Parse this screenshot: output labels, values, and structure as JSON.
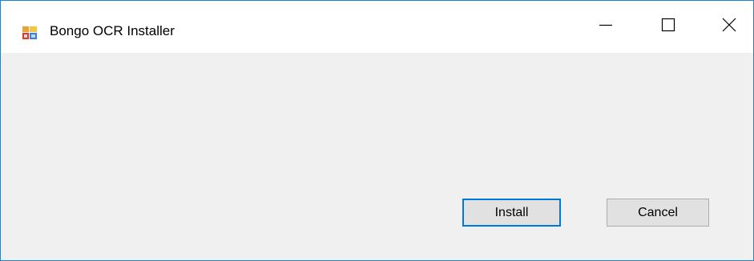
{
  "window": {
    "title": "Bongo OCR Installer",
    "app_icon": "installer-app-icon",
    "accent_border": "#1883d7"
  },
  "caption_buttons": {
    "minimize_icon": "minimize-icon",
    "maximize_icon": "maximize-icon",
    "close_icon": "close-icon"
  },
  "buttons": {
    "install_label": "Install",
    "cancel_label": "Cancel",
    "default_focus_color": "#0078d7"
  }
}
